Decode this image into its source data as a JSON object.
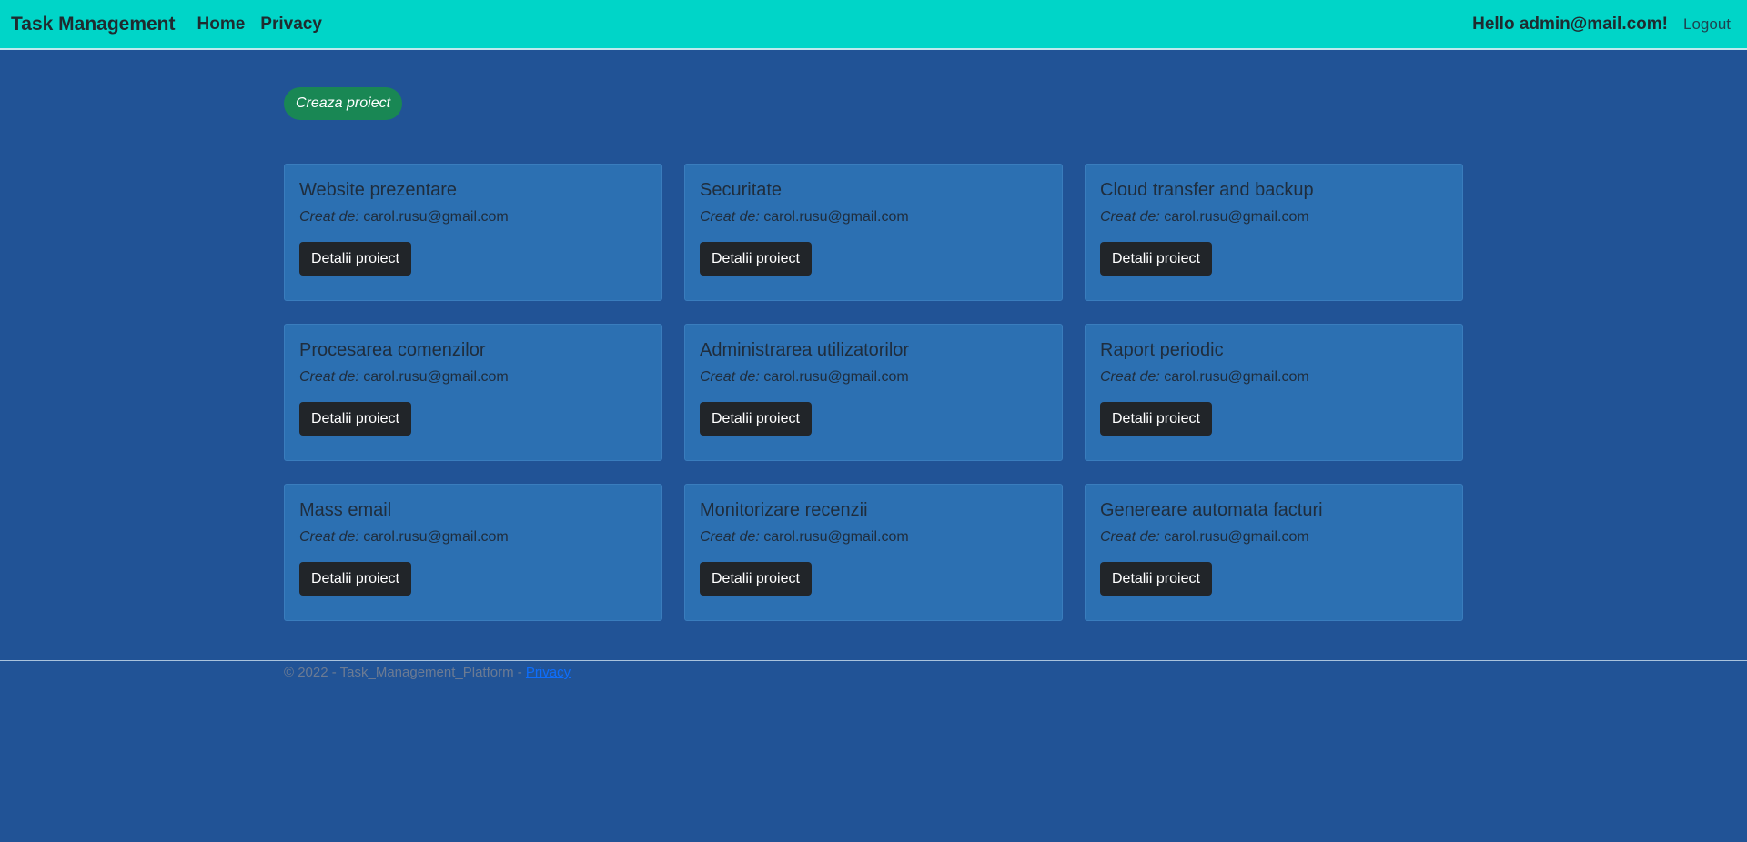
{
  "navbar": {
    "brand": "Task Management",
    "links": [
      "Home",
      "Privacy"
    ],
    "greeting": "Hello admin@mail.com!",
    "logout": "Logout"
  },
  "main": {
    "create_button": "Creaza proiect",
    "author_label": "Creat de:",
    "details_button": "Detalii proiect",
    "projects": [
      {
        "title": "Website prezentare",
        "author": "carol.rusu@gmail.com"
      },
      {
        "title": "Securitate",
        "author": "carol.rusu@gmail.com"
      },
      {
        "title": "Cloud transfer and backup",
        "author": "carol.rusu@gmail.com"
      },
      {
        "title": "Procesarea comenzilor",
        "author": "carol.rusu@gmail.com"
      },
      {
        "title": "Administrarea utilizatorilor",
        "author": "carol.rusu@gmail.com"
      },
      {
        "title": "Raport periodic",
        "author": "carol.rusu@gmail.com"
      },
      {
        "title": "Mass email",
        "author": "carol.rusu@gmail.com"
      },
      {
        "title": "Monitorizare recenzii",
        "author": "carol.rusu@gmail.com"
      },
      {
        "title": "Genereare automata facturi",
        "author": "carol.rusu@gmail.com"
      }
    ]
  },
  "footer": {
    "text": "© 2022 - Task_Management_Platform - ",
    "privacy_link": "Privacy"
  },
  "colors": {
    "background": "#215396",
    "navbar": "#00d5c8",
    "card": "#2c70b2",
    "create_button": "#198754",
    "details_button": "#212529",
    "link": "#0d6efd"
  }
}
